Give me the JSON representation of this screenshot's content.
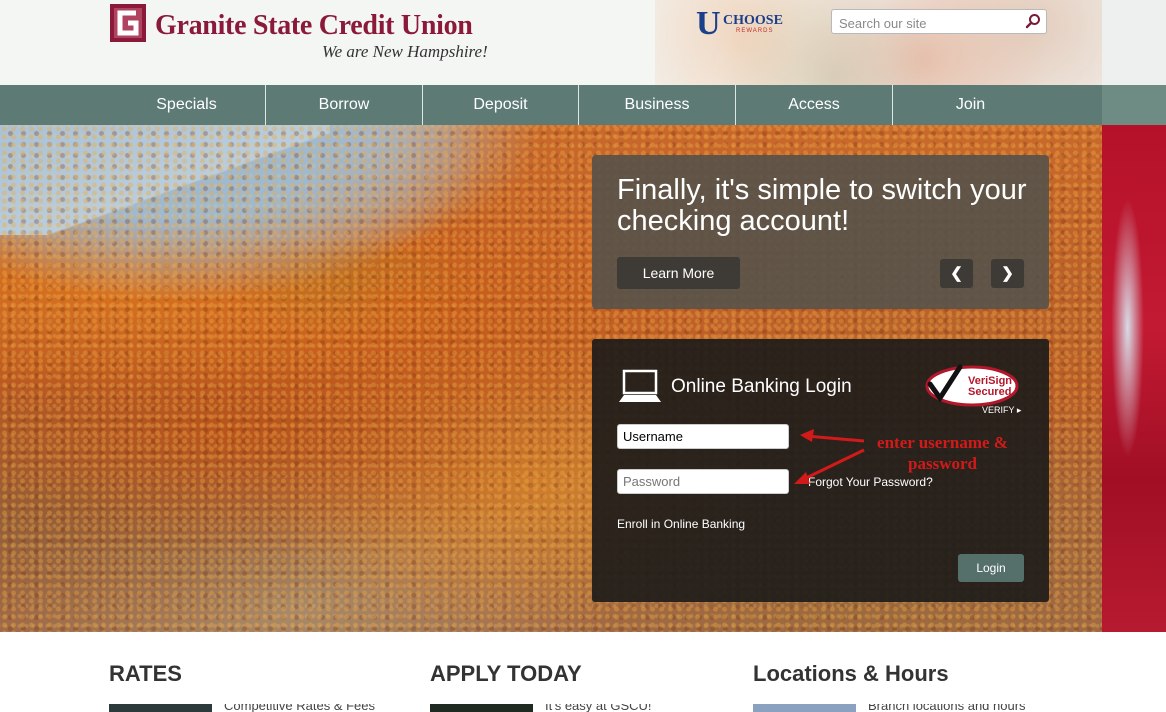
{
  "header": {
    "brand_name": "Granite State Credit Union",
    "tagline": "We are New Hampshire!",
    "partner_logo": {
      "u": "U",
      "choose": "CHOOSE",
      "rewards": "REWARDS"
    },
    "search": {
      "placeholder": "Search our site",
      "value": ""
    },
    "colors": {
      "brand": "#8b1a3a",
      "nav": "#5d7b74"
    }
  },
  "nav": {
    "items": [
      {
        "label": "Specials"
      },
      {
        "label": "Borrow"
      },
      {
        "label": "Deposit"
      },
      {
        "label": "Business"
      },
      {
        "label": "Access"
      },
      {
        "label": "Join"
      }
    ]
  },
  "promo": {
    "title": "Finally, it's simple to switch your checking account!",
    "button_label": "Learn More",
    "prev_label": "❮",
    "next_label": "❯"
  },
  "login": {
    "title": "Online Banking Login",
    "verisign_line1": "VeriSign",
    "verisign_line2": "Secured",
    "verify_label": "VERIFY ▸",
    "username_placeholder": "Username",
    "password_placeholder": "Password",
    "forgot_label": "Forgot Your Password?",
    "enroll_label": "Enroll in Online Banking",
    "button_label": "Login"
  },
  "annotation": {
    "text_line1": "enter username &",
    "text_line2": "password",
    "color": "#d31a1a"
  },
  "bottom": {
    "columns": [
      {
        "title": "RATES",
        "text": "Competitive Rates & Fees"
      },
      {
        "title": "APPLY TODAY",
        "text": "It's easy at GSCU!"
      },
      {
        "title": "Locations & Hours",
        "text": "Branch locations and hours"
      }
    ]
  }
}
